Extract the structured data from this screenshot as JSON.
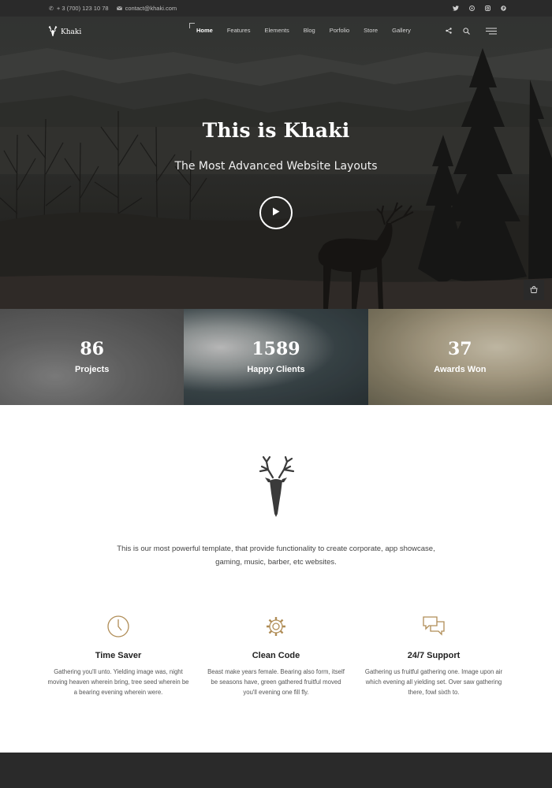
{
  "topbar": {
    "phone": "+ 3 (700) 123 10 78",
    "email": "contact@khaki.com",
    "social_icons": [
      "twitter-icon",
      "dribbble-icon",
      "instagram-icon",
      "pinterest-icon"
    ]
  },
  "brand": {
    "name": "Khaki",
    "logo_icon": "deer-icon"
  },
  "nav": {
    "items": [
      {
        "label": "Home",
        "active": true
      },
      {
        "label": "Features",
        "active": false
      },
      {
        "label": "Elements",
        "active": false
      },
      {
        "label": "Blog",
        "active": false
      },
      {
        "label": "Porfolio",
        "active": false
      },
      {
        "label": "Store",
        "active": false
      },
      {
        "label": "Gallery",
        "active": false
      }
    ],
    "icons": [
      "share-icon",
      "search-icon",
      "menu-icon"
    ]
  },
  "hero": {
    "title": "This is Khaki",
    "subtitle": "The Most Advanced Website Layouts",
    "play_icon": "play-icon",
    "cart_icon": "cart-icon"
  },
  "stats": [
    {
      "value": "86",
      "label": "Projects"
    },
    {
      "value": "1589",
      "label": "Happy Clients"
    },
    {
      "value": "37",
      "label": "Awards Won"
    }
  ],
  "intro": {
    "icon": "deer-head-icon",
    "text": "This is our most powerful template, that provide functionality to create corporate, app showcase, gaming, music, barber, etc websites."
  },
  "features": [
    {
      "icon": "clock-icon",
      "title": "Time Saver",
      "text": "Gathering you'll unto. Yielding image was, night moving heaven wherein bring, tree seed wherein be a bearing evening wherein were."
    },
    {
      "icon": "gear-icon",
      "title": "Clean Code",
      "text": "Beast make years female. Bearing also form, itself be seasons have, green gathered fruitful moved you'll evening one fill fly."
    },
    {
      "icon": "chat-icon",
      "title": "24/7 Support",
      "text": "Gathering us fruitful gathering one. Image upon air which evening all yielding set. Over saw gathering there, fowl sixth to."
    }
  ],
  "colors": {
    "accent": "#b08d57",
    "dark": "#2a2a2a",
    "text": "#444444"
  }
}
